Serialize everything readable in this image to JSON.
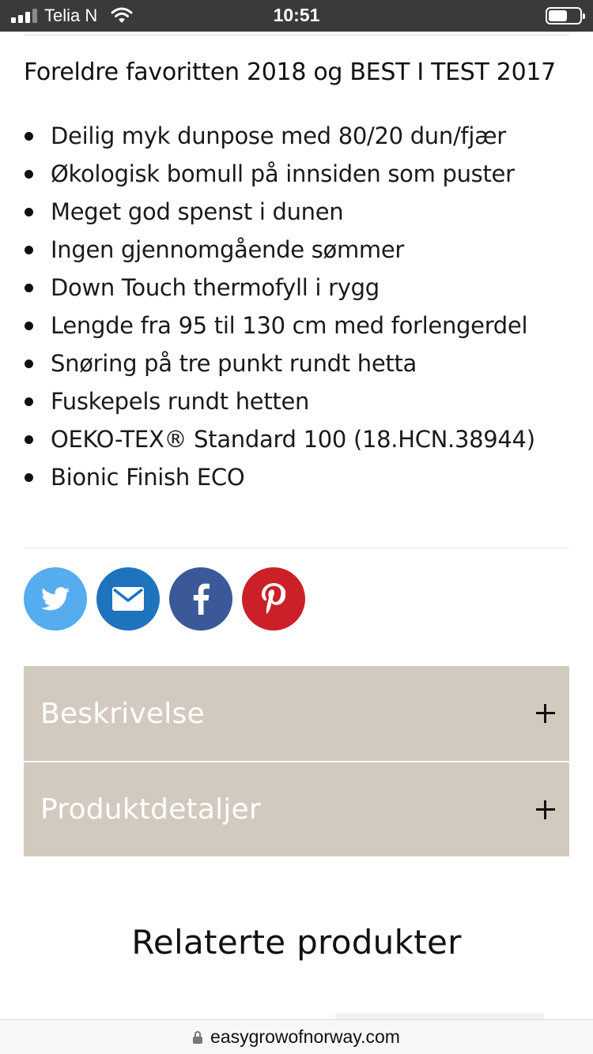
{
  "status_bar": {
    "carrier": "Telia N",
    "time": "10:51",
    "signal_bars_filled": 3,
    "signal_bars_total": 4,
    "battery_level": 0.6
  },
  "product": {
    "subtitle": "Foreldre favoritten 2018 og BEST I TEST 2017",
    "features": [
      "Deilig myk dunpose med 80/20 dun/fjær",
      "Økologisk bomull på innsiden som puster",
      "Meget god spenst i dunen",
      "Ingen gjennomgående sømmer",
      "Down Touch thermofyll i rygg",
      "Lengde fra 95 til 130 cm med forlengerdel",
      "Snøring på tre punkt rundt hetta",
      "Fuskepels rundt hetten",
      "OEKO-TEX® Standard 100 (18.HCN.38944)",
      "Bionic Finish ECO"
    ]
  },
  "share": {
    "buttons": [
      {
        "icon": "twitter-icon",
        "color": "#55acee"
      },
      {
        "icon": "email-icon",
        "color": "#1e73be"
      },
      {
        "icon": "facebook-icon",
        "color": "#3b5998"
      },
      {
        "icon": "pinterest-icon",
        "color": "#cb2027"
      }
    ]
  },
  "accordion": {
    "items": [
      {
        "label": "Beskrivelse"
      },
      {
        "label": "Produktdetaljer"
      }
    ],
    "background": "#d2c9bf"
  },
  "related": {
    "title": "Relaterte produkter"
  },
  "browser": {
    "url": "easygrowofnorway.com"
  }
}
